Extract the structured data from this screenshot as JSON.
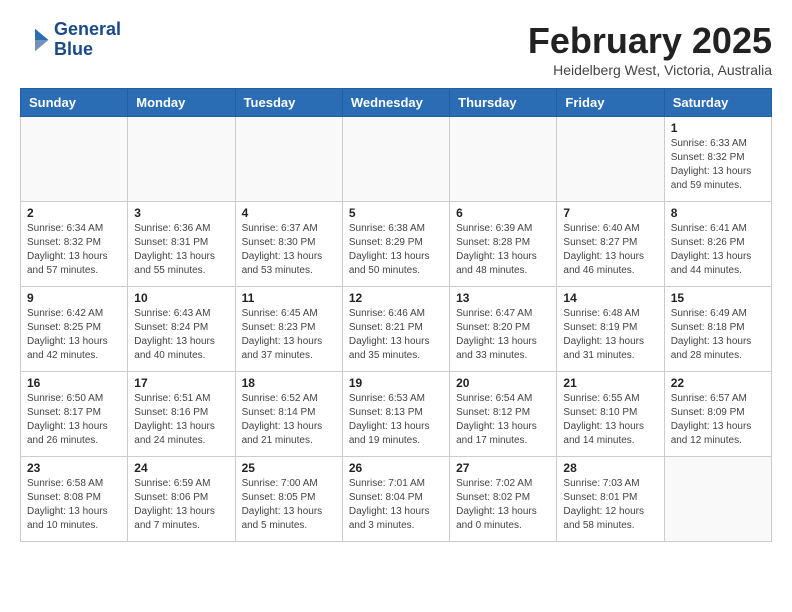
{
  "header": {
    "logo_line1": "General",
    "logo_line2": "Blue",
    "month_title": "February 2025",
    "location": "Heidelberg West, Victoria, Australia"
  },
  "days_of_week": [
    "Sunday",
    "Monday",
    "Tuesday",
    "Wednesday",
    "Thursday",
    "Friday",
    "Saturday"
  ],
  "weeks": [
    [
      {
        "day": "",
        "info": ""
      },
      {
        "day": "",
        "info": ""
      },
      {
        "day": "",
        "info": ""
      },
      {
        "day": "",
        "info": ""
      },
      {
        "day": "",
        "info": ""
      },
      {
        "day": "",
        "info": ""
      },
      {
        "day": "1",
        "info": "Sunrise: 6:33 AM\nSunset: 8:32 PM\nDaylight: 13 hours and 59 minutes."
      }
    ],
    [
      {
        "day": "2",
        "info": "Sunrise: 6:34 AM\nSunset: 8:32 PM\nDaylight: 13 hours and 57 minutes."
      },
      {
        "day": "3",
        "info": "Sunrise: 6:36 AM\nSunset: 8:31 PM\nDaylight: 13 hours and 55 minutes."
      },
      {
        "day": "4",
        "info": "Sunrise: 6:37 AM\nSunset: 8:30 PM\nDaylight: 13 hours and 53 minutes."
      },
      {
        "day": "5",
        "info": "Sunrise: 6:38 AM\nSunset: 8:29 PM\nDaylight: 13 hours and 50 minutes."
      },
      {
        "day": "6",
        "info": "Sunrise: 6:39 AM\nSunset: 8:28 PM\nDaylight: 13 hours and 48 minutes."
      },
      {
        "day": "7",
        "info": "Sunrise: 6:40 AM\nSunset: 8:27 PM\nDaylight: 13 hours and 46 minutes."
      },
      {
        "day": "8",
        "info": "Sunrise: 6:41 AM\nSunset: 8:26 PM\nDaylight: 13 hours and 44 minutes."
      }
    ],
    [
      {
        "day": "9",
        "info": "Sunrise: 6:42 AM\nSunset: 8:25 PM\nDaylight: 13 hours and 42 minutes."
      },
      {
        "day": "10",
        "info": "Sunrise: 6:43 AM\nSunset: 8:24 PM\nDaylight: 13 hours and 40 minutes."
      },
      {
        "day": "11",
        "info": "Sunrise: 6:45 AM\nSunset: 8:23 PM\nDaylight: 13 hours and 37 minutes."
      },
      {
        "day": "12",
        "info": "Sunrise: 6:46 AM\nSunset: 8:21 PM\nDaylight: 13 hours and 35 minutes."
      },
      {
        "day": "13",
        "info": "Sunrise: 6:47 AM\nSunset: 8:20 PM\nDaylight: 13 hours and 33 minutes."
      },
      {
        "day": "14",
        "info": "Sunrise: 6:48 AM\nSunset: 8:19 PM\nDaylight: 13 hours and 31 minutes."
      },
      {
        "day": "15",
        "info": "Sunrise: 6:49 AM\nSunset: 8:18 PM\nDaylight: 13 hours and 28 minutes."
      }
    ],
    [
      {
        "day": "16",
        "info": "Sunrise: 6:50 AM\nSunset: 8:17 PM\nDaylight: 13 hours and 26 minutes."
      },
      {
        "day": "17",
        "info": "Sunrise: 6:51 AM\nSunset: 8:16 PM\nDaylight: 13 hours and 24 minutes."
      },
      {
        "day": "18",
        "info": "Sunrise: 6:52 AM\nSunset: 8:14 PM\nDaylight: 13 hours and 21 minutes."
      },
      {
        "day": "19",
        "info": "Sunrise: 6:53 AM\nSunset: 8:13 PM\nDaylight: 13 hours and 19 minutes."
      },
      {
        "day": "20",
        "info": "Sunrise: 6:54 AM\nSunset: 8:12 PM\nDaylight: 13 hours and 17 minutes."
      },
      {
        "day": "21",
        "info": "Sunrise: 6:55 AM\nSunset: 8:10 PM\nDaylight: 13 hours and 14 minutes."
      },
      {
        "day": "22",
        "info": "Sunrise: 6:57 AM\nSunset: 8:09 PM\nDaylight: 13 hours and 12 minutes."
      }
    ],
    [
      {
        "day": "23",
        "info": "Sunrise: 6:58 AM\nSunset: 8:08 PM\nDaylight: 13 hours and 10 minutes."
      },
      {
        "day": "24",
        "info": "Sunrise: 6:59 AM\nSunset: 8:06 PM\nDaylight: 13 hours and 7 minutes."
      },
      {
        "day": "25",
        "info": "Sunrise: 7:00 AM\nSunset: 8:05 PM\nDaylight: 13 hours and 5 minutes."
      },
      {
        "day": "26",
        "info": "Sunrise: 7:01 AM\nSunset: 8:04 PM\nDaylight: 13 hours and 3 minutes."
      },
      {
        "day": "27",
        "info": "Sunrise: 7:02 AM\nSunset: 8:02 PM\nDaylight: 13 hours and 0 minutes."
      },
      {
        "day": "28",
        "info": "Sunrise: 7:03 AM\nSunset: 8:01 PM\nDaylight: 12 hours and 58 minutes."
      },
      {
        "day": "",
        "info": ""
      }
    ]
  ]
}
